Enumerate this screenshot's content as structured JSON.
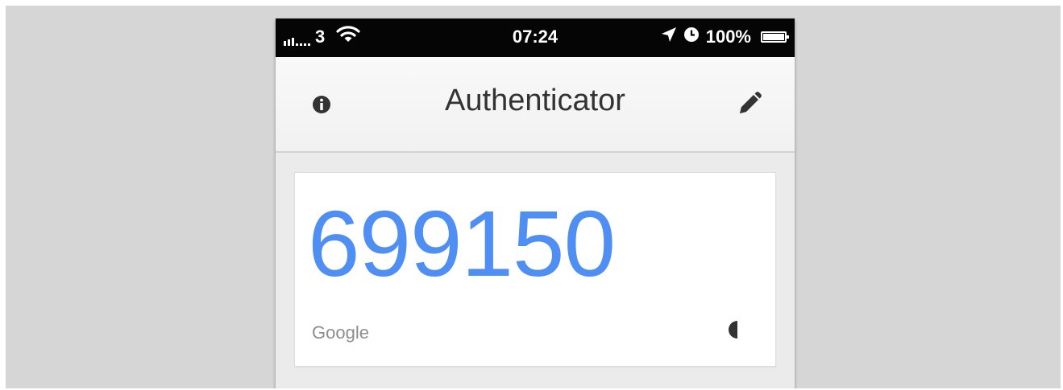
{
  "status_bar": {
    "carrier": "3",
    "time": "07:24",
    "battery": "100%",
    "battery_level": 1.0,
    "icons": [
      "signal-icon",
      "wifi-icon",
      "location-arrow-icon",
      "alarm-clock-icon",
      "battery-icon"
    ]
  },
  "header": {
    "title": "Authenticator",
    "left_icon": "info-icon",
    "right_icon": "pencil-edit-icon"
  },
  "accounts": [
    {
      "code": "699150",
      "issuer": "Google",
      "timer_icon": "countdown-pie-icon",
      "timer_remaining_fraction": 0.5
    }
  ],
  "colors": {
    "code": "#4f8ef2",
    "backdrop": "#d6d6d6",
    "statusbar": "#050505",
    "account_label": "#8d8d8d"
  }
}
